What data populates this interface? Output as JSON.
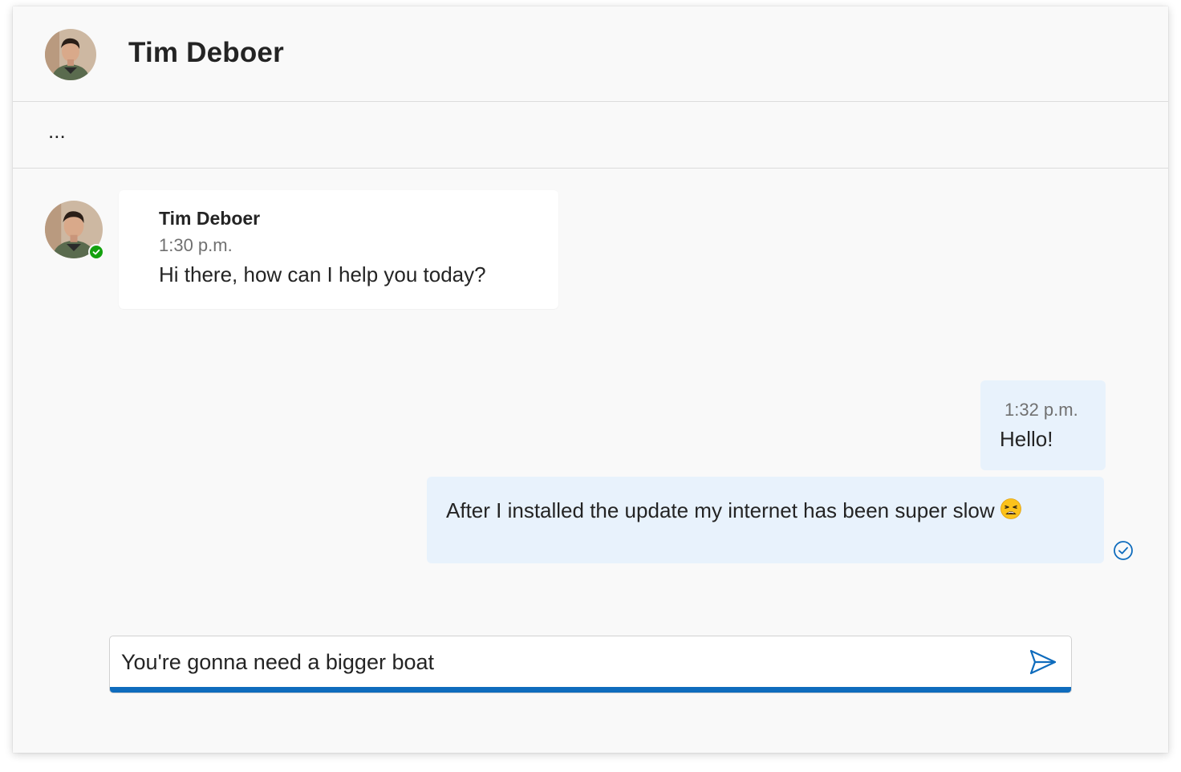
{
  "header": {
    "contact_name": "Tim Deboer",
    "avatar_icon": "person-avatar"
  },
  "toolbar": {
    "more_label": "..."
  },
  "messages": [
    {
      "direction": "incoming",
      "sender": "Tim Deboer",
      "time": "1:30 p.m.",
      "text": "Hi there, how can I help you today?",
      "presence": "available"
    },
    {
      "direction": "outgoing",
      "time": "1:32 p.m.",
      "text": "Hello!"
    },
    {
      "direction": "outgoing",
      "text": "After I installed the update my internet has been super slow",
      "emoji": "weary-face",
      "status_icon": "read-receipt-icon"
    }
  ],
  "composer": {
    "value": "You're gonna need a bigger boat",
    "send_icon": "send-icon"
  },
  "colors": {
    "accent": "#0f6cbd",
    "outgoing_bubble": "#e8f2fc",
    "presence_available": "#13a10e",
    "background": "#f9f9f9"
  }
}
